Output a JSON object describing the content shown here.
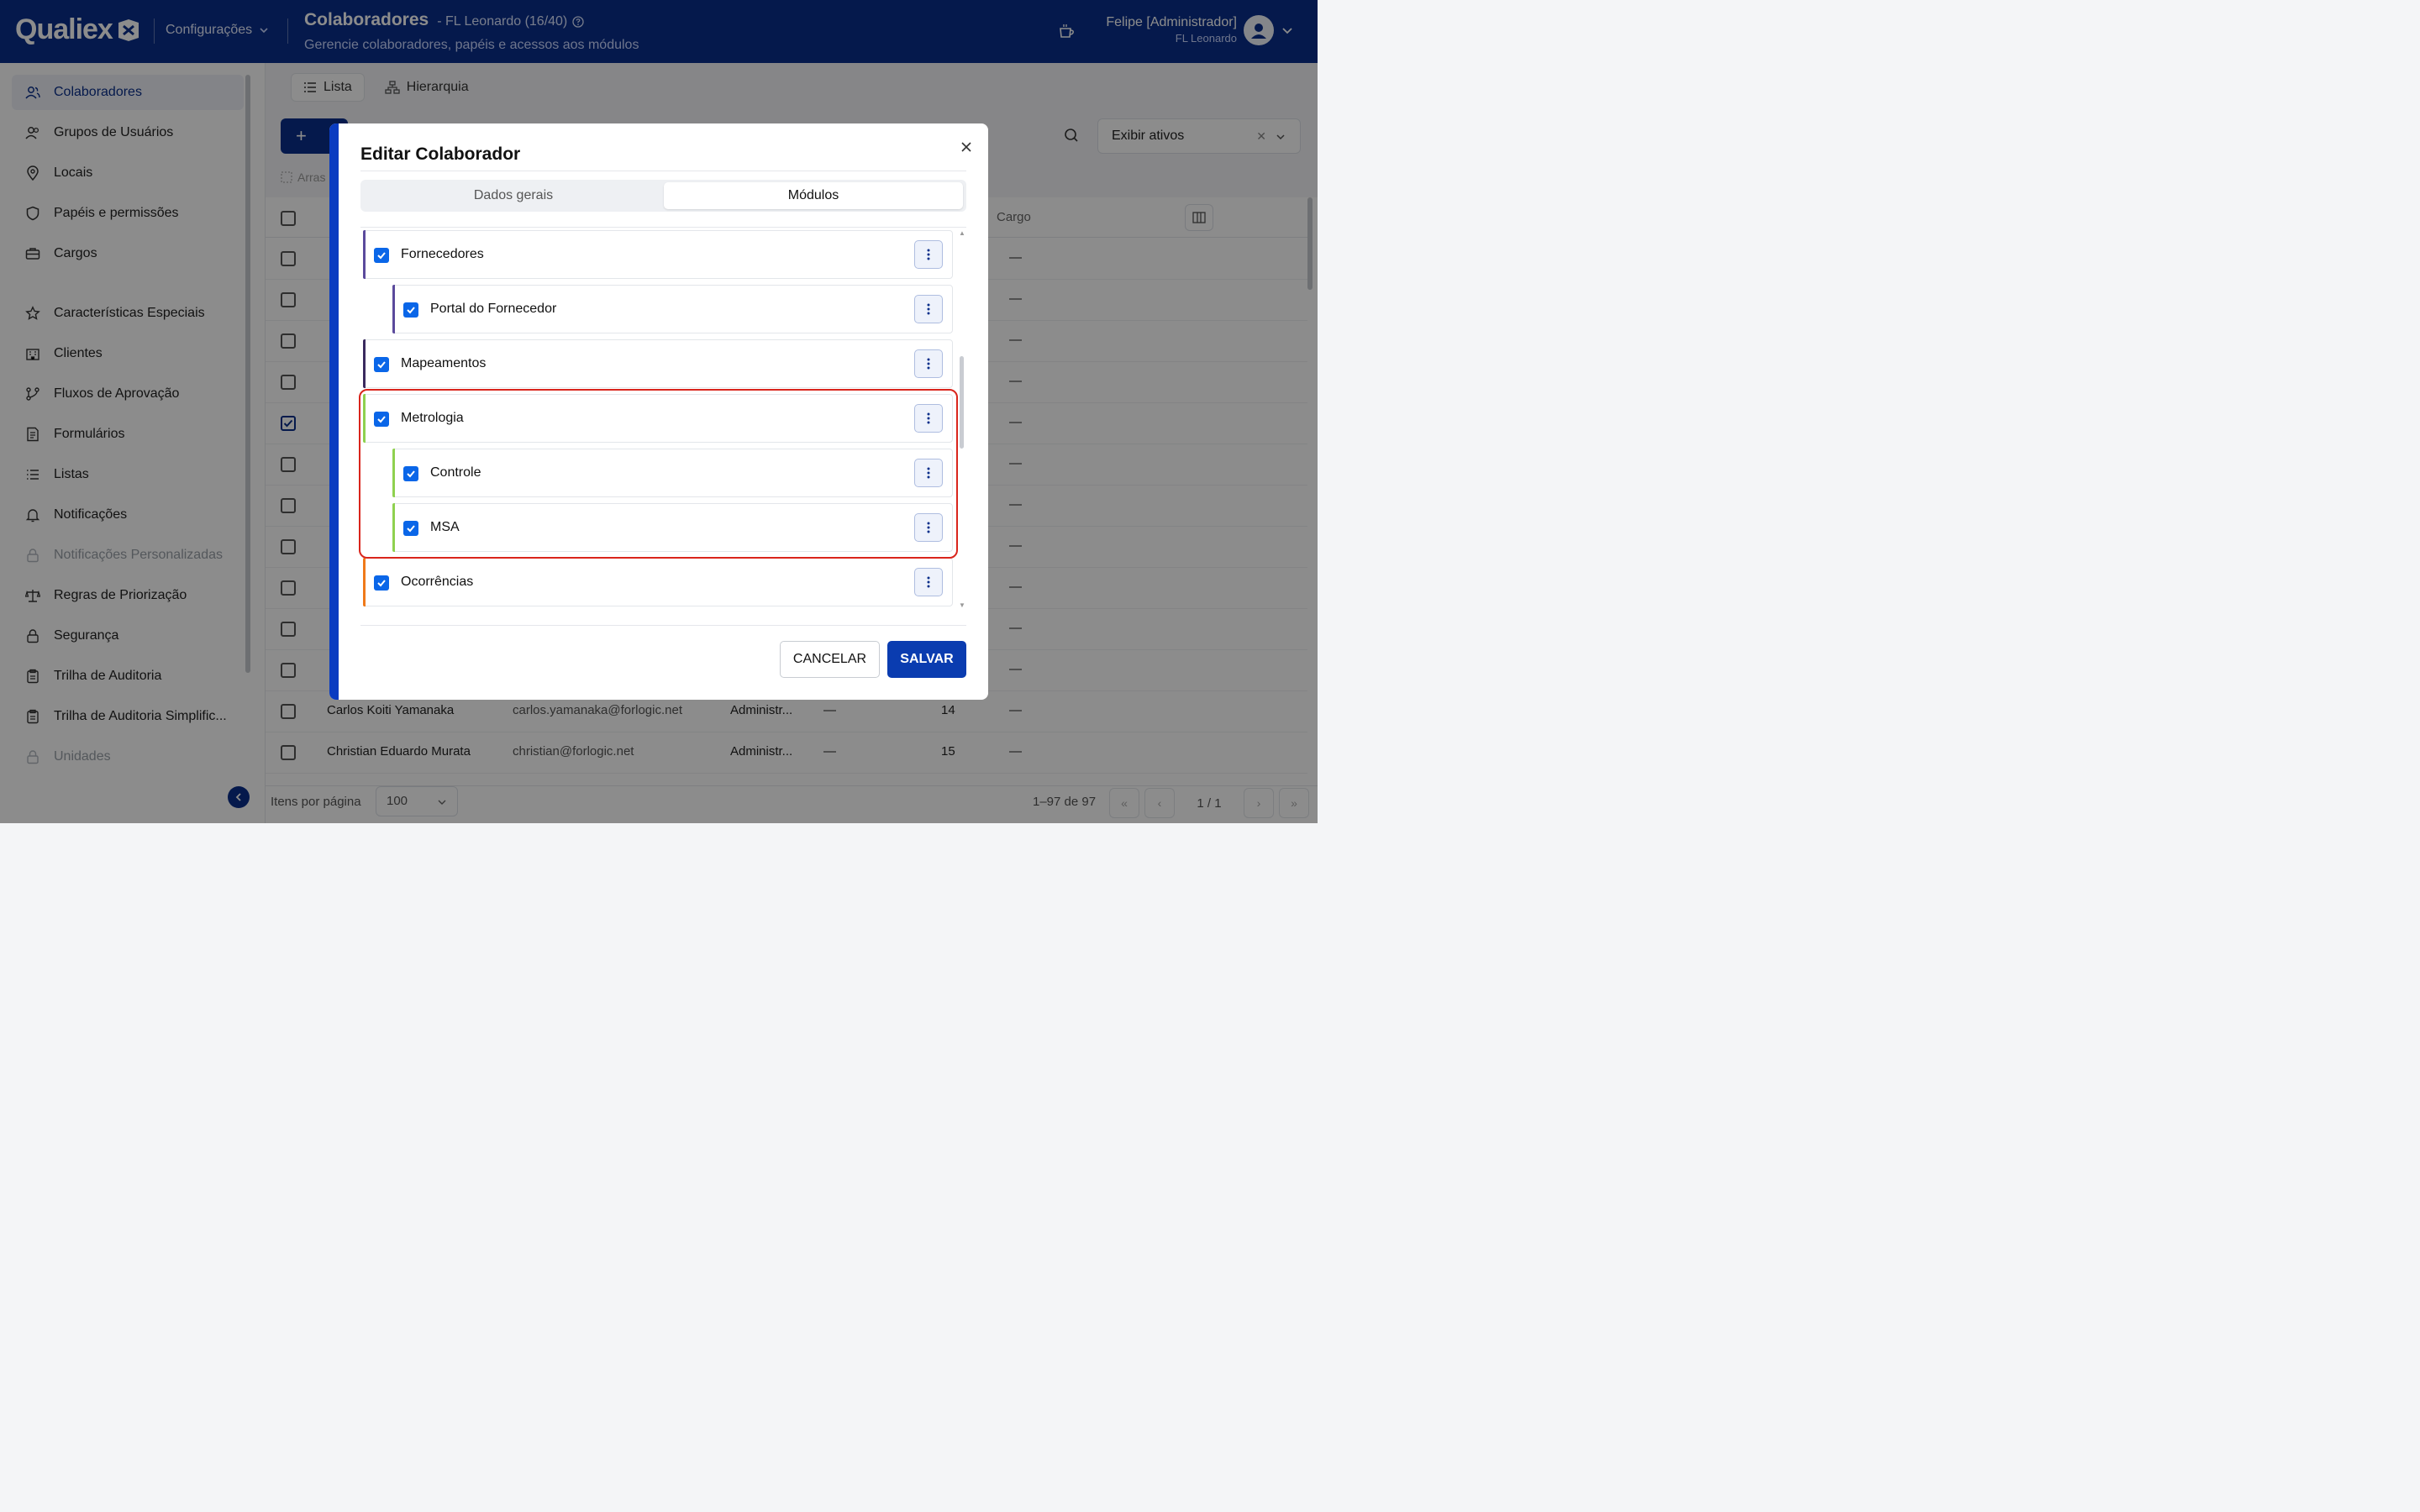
{
  "header": {
    "brand": "Qualiex",
    "section": "Configurações",
    "title": "Colaboradores",
    "subtitle": "- FL Leonardo (16/40)",
    "description": "Gerencie colaboradores, papéis e acessos aos módulos",
    "user_name": "Felipe [Administrador]",
    "user_org": "FL Leonardo"
  },
  "sidebar": {
    "items": [
      {
        "label": "Colaboradores",
        "icon": "users-icon",
        "state": "active"
      },
      {
        "label": "Grupos de Usuários",
        "icon": "user-group-icon",
        "state": "normal"
      },
      {
        "label": "Locais",
        "icon": "location-pin-icon",
        "state": "normal"
      },
      {
        "label": "Papéis e permissões",
        "icon": "shield-icon",
        "state": "normal"
      },
      {
        "label": "Cargos",
        "icon": "briefcase-icon",
        "state": "normal"
      },
      {
        "label": "Características Especiais",
        "icon": "star-icon",
        "state": "normal"
      },
      {
        "label": "Clientes",
        "icon": "building-icon",
        "state": "normal"
      },
      {
        "label": "Fluxos de Aprovação",
        "icon": "flow-icon",
        "state": "normal"
      },
      {
        "label": "Formulários",
        "icon": "form-icon",
        "state": "normal"
      },
      {
        "label": "Listas",
        "icon": "list-icon",
        "state": "normal"
      },
      {
        "label": "Notificações",
        "icon": "bell-icon",
        "state": "normal"
      },
      {
        "label": "Notificações Personalizadas",
        "icon": "lock-icon",
        "state": "disabled"
      },
      {
        "label": "Regras de Priorização",
        "icon": "scale-icon",
        "state": "normal"
      },
      {
        "label": "Segurança",
        "icon": "lock-icon",
        "state": "normal"
      },
      {
        "label": "Trilha de Auditoria",
        "icon": "clipboard-icon",
        "state": "normal"
      },
      {
        "label": "Trilha de Auditoria Simplific...",
        "icon": "clipboard-icon",
        "state": "normal"
      },
      {
        "label": "Unidades",
        "icon": "lock-icon",
        "state": "disabled"
      }
    ]
  },
  "main": {
    "view_tabs": [
      "Lista",
      "Hierarquia"
    ],
    "new_button": "+",
    "filter_value": "Exibir ativos",
    "drag_hint": "Arras",
    "column_cargo": "Cargo",
    "rows": [
      {
        "name": "Carlos Koiti Yamanaka",
        "email": "carlos.yamanaka@forlogic.net",
        "role": "Administr...",
        "dash": "—",
        "num": "14",
        "cargo": "—"
      },
      {
        "name": "Christian Eduardo Murata",
        "email": "christian@forlogic.net",
        "role": "Administr...",
        "dash": "—",
        "num": "15",
        "cargo": "—"
      }
    ],
    "empty_cell": "—",
    "items_per_page_label": "Itens por página",
    "items_per_page_value": "100",
    "range": "1–97 de 97",
    "page": "1 / 1"
  },
  "modal": {
    "title": "Editar Colaborador",
    "tabs": [
      "Dados gerais",
      "Módulos"
    ],
    "active_tab": "Módulos",
    "modules": [
      {
        "label": "Fornecedores",
        "level": 0,
        "color": "#5b4a9c"
      },
      {
        "label": "Portal do Fornecedor",
        "level": 1,
        "color": "#5b4a9c"
      },
      {
        "label": "Mapeamentos",
        "level": 0,
        "color": "#3a2a5e"
      },
      {
        "label": "Metrologia",
        "level": 0,
        "color": "#8fd14f"
      },
      {
        "label": "Controle",
        "level": 1,
        "color": "#8fd14f"
      },
      {
        "label": "MSA",
        "level": 1,
        "color": "#8fd14f"
      },
      {
        "label": "Ocorrências",
        "level": 0,
        "color": "#f07a1a"
      }
    ],
    "cancel_label": "CANCELAR",
    "save_label": "SALVAR"
  },
  "colors": {
    "brand": "#0a2f8a",
    "checkbox": "#0a66e8",
    "highlight": "#d9251c"
  }
}
